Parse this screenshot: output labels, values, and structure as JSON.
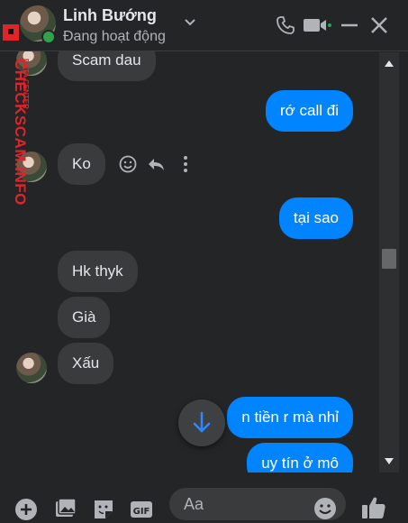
{
  "header": {
    "contact_name": "Linh Bướng",
    "status": "Đang hoạt động",
    "icons": [
      "chevron-down-icon",
      "phone-icon",
      "video-camera-icon",
      "minimize-icon",
      "close-icon"
    ]
  },
  "watermark": {
    "site": "CHECKSCAM.INFO",
    "tagline": "DATA CENTER"
  },
  "messages": [
    {
      "direction": "incoming",
      "text": "Scam dau"
    },
    {
      "direction": "outgoing",
      "text": "rớ call đi"
    },
    {
      "direction": "incoming",
      "text": "Ko"
    },
    {
      "direction": "outgoing",
      "text": "tại sao"
    },
    {
      "direction": "incoming",
      "text": "Hk thyk"
    },
    {
      "direction": "incoming",
      "text": "Già"
    },
    {
      "direction": "incoming",
      "text": "Xấu"
    },
    {
      "direction": "outgoing",
      "text": "n tiền r mà nhỉ"
    },
    {
      "direction": "outgoing",
      "text": "uy tín ở mô"
    }
  ],
  "message_actions": [
    "emoji-react-icon",
    "reply-icon",
    "more-options-icon"
  ],
  "composer": {
    "placeholder": "Aa",
    "icons": [
      "plus-icon",
      "image-icon",
      "sticker-icon",
      "gif-icon",
      "emoji-icon",
      "like-icon"
    ]
  },
  "colors": {
    "background": "#242526",
    "incoming_bubble": "#3a3b3c",
    "outgoing_bubble": "#0084ff",
    "online": "#31a24c",
    "watermark": "#e0242a"
  }
}
